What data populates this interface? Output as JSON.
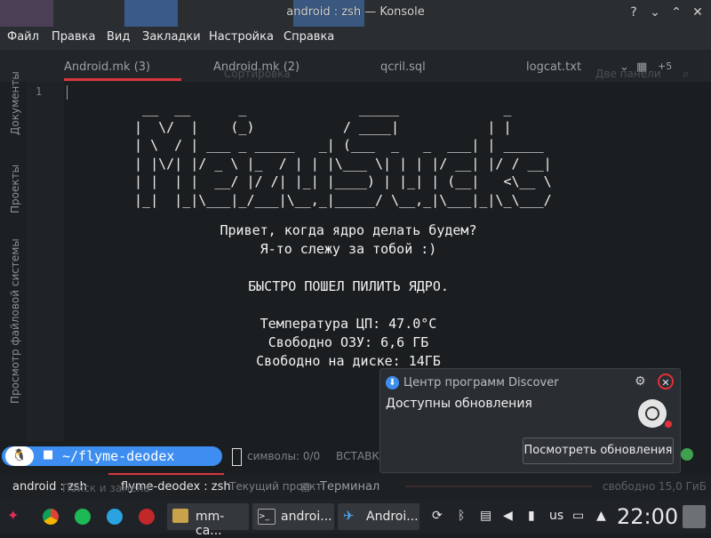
{
  "window": {
    "title": "android : zsh — Konsole",
    "controls": {
      "help": "?",
      "minimize": "⌄",
      "maximize": "⌃",
      "close": "✕"
    }
  },
  "menu": [
    "Файл",
    "Правка",
    "Вид",
    "Закладки",
    "Настройка",
    "Справка"
  ],
  "editor_tabs": [
    "Android.mk (3)",
    "Android.mk (2)",
    "qcril.sql",
    "logcat.txt"
  ],
  "editor_tabs_extra": {
    "more_count": "+5",
    "split_label": "Две панели",
    "sort_label": "Сортировка"
  },
  "left_panels": [
    "Документы",
    "Проекты",
    "Просмотр файловой системы"
  ],
  "line_number": "1",
  "ascii_art": "  __  __      _              _____             _\n |  \\/  |    (_)           / ____|           | |\n | \\  / | ___ _ _____   _| (___  _   _  ___| | _____\n | |\\/| |/ _ \\ |_  / | | |\\___ \\| | | |/ __| |/ / __|\n | |  | |  __/ |/ /| |_| |____) | |_| | (__|   <\\__ \\\n |_|  |_|\\___|_/___|\\__,_|_____/ \\__,_|\\___|_|\\_\\___/",
  "terminal": {
    "greeting1": "Привет, когда ядро делать будем?",
    "greeting2": "Я-то слежу за тобой :)",
    "warning": "БЫСТРО ПОШЕЛ ПИЛИТЬ ЯДРО.",
    "cpu_temp": "Температура ЦП: 47.0°C",
    "ram_free": "Свободно ОЗУ: 6,6 ГБ",
    "disk_free": "Свободно на диске: 14ГБ"
  },
  "prompt": {
    "path": "~/flyme-deodex",
    "icon": "tux-icon"
  },
  "editor_status": {
    "symbols": "символы: 0/0",
    "mode": "ВСТАВКА"
  },
  "bottom_tabs": [
    "android : zsh",
    "flyme-deodex : zsh"
  ],
  "bottom_ghost": {
    "search": "Поиск и замена",
    "project": "Текущий проект",
    "terminal": "Терминал",
    "free": "свободно 15,0 ГиБ"
  },
  "notification": {
    "app": "Центр программ Discover",
    "title": "Доступны обновления",
    "button": "Посмотреть обновления"
  },
  "taskbar": {
    "tasks": [
      "mm-ca...",
      "androi...",
      "Androi..."
    ],
    "keyboard_layout": "us",
    "clock": "22:00"
  },
  "colors": {
    "accent": "#3d8ef0",
    "close_red": "#e0303a",
    "tab_underline": "#d9363e"
  }
}
